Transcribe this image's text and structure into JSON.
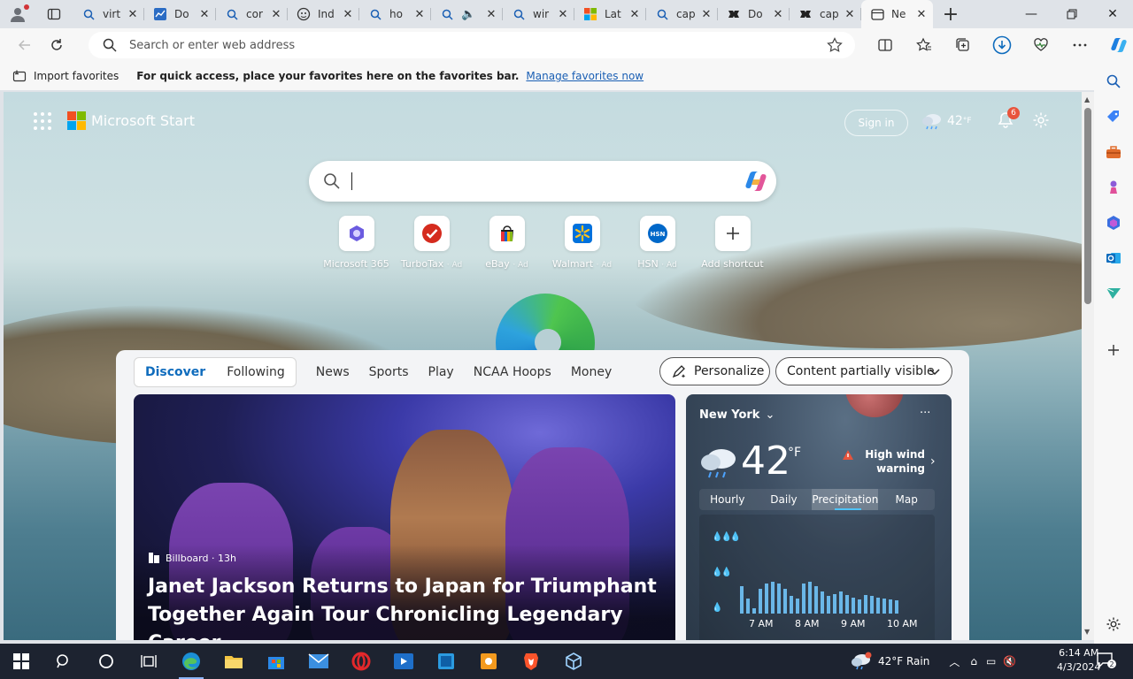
{
  "browser": {
    "tabs": [
      {
        "title": "virt",
        "icon": "search-icon"
      },
      {
        "title": "Do",
        "icon": "chart-icon"
      },
      {
        "title": "cor",
        "icon": "search-icon"
      },
      {
        "title": "Ind",
        "icon": "head-icon"
      },
      {
        "title": "ho",
        "icon": "search-icon"
      },
      {
        "title": "",
        "icon": "search-icon"
      },
      {
        "title": "wir",
        "icon": "search-icon"
      },
      {
        "title": "Lat",
        "icon": "microsoft-icon"
      },
      {
        "title": "cap",
        "icon": "search-icon"
      },
      {
        "title": "Do",
        "icon": "capcut-icon"
      },
      {
        "title": "cap",
        "icon": "capcut-icon"
      },
      {
        "title": "Ne",
        "icon": "newtab-icon"
      }
    ],
    "address_placeholder": "Search or enter web address",
    "favorites_bar": {
      "import_label": "Import favorites",
      "message": "For quick access, place your favorites here on the favorites bar.",
      "link": "Manage favorites now"
    }
  },
  "page": {
    "brand": "Microsoft Start",
    "sign_in": "Sign in",
    "top_weather_temp": "42",
    "top_weather_unit": "°F",
    "notification_count": "6",
    "shortcuts": [
      {
        "label": "Microsoft 365",
        "ad": ""
      },
      {
        "label": "TurboTax",
        "ad": "· Ad"
      },
      {
        "label": "eBay",
        "ad": "· Ad"
      },
      {
        "label": "Walmart",
        "ad": "· Ad"
      },
      {
        "label": "HSN",
        "ad": "· Ad"
      },
      {
        "label": "Add shortcut",
        "ad": ""
      }
    ],
    "feed_nav": {
      "primary": [
        "Discover",
        "Following"
      ],
      "items": [
        "News",
        "Sports",
        "Play",
        "NCAA Hoops",
        "Money"
      ],
      "more": "···",
      "personalize": "Personalize",
      "content_filter": "Content partially visible"
    },
    "hero": {
      "source": "Billboard · 13h",
      "headline": "Janet Jackson Returns to Japan for Triumphant Together Again Tour Chronicling Legendary Career"
    },
    "weather": {
      "city": "New York",
      "temp": "42",
      "unit": "°F",
      "alert": "High wind warning",
      "tabs": [
        "Hourly",
        "Daily",
        "Precipitation",
        "Map"
      ],
      "active_tab": "Precipitation",
      "times": [
        "7 AM",
        "8 AM",
        "9 AM",
        "10 AM"
      ],
      "precip_bars": [
        0.55,
        0.3,
        0.1,
        0.5,
        0.6,
        0.65,
        0.6,
        0.5,
        0.35,
        0.3,
        0.6,
        0.65,
        0.55,
        0.45,
        0.35,
        0.4,
        0.45,
        0.38,
        0.32,
        0.28,
        0.38,
        0.35,
        0.32,
        0.3,
        0.28,
        0.26
      ]
    }
  },
  "taskbar": {
    "weather": "42°F  Rain",
    "time": "6:14 AM",
    "date": "4/3/2024",
    "notification_count": "2"
  },
  "colors": {
    "accent": "#0f6cbd",
    "taskbar": "#1d2330"
  }
}
